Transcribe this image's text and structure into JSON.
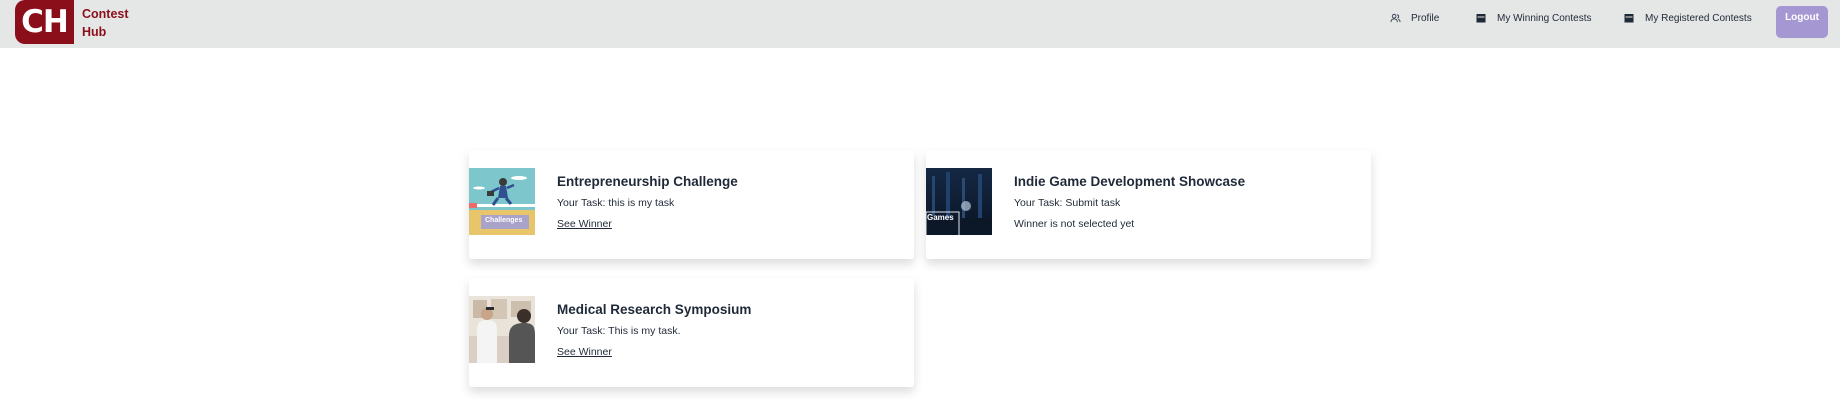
{
  "brand": {
    "badge": "CH",
    "name": "Contest Hub",
    "color": "#8b0f1a"
  },
  "nav": {
    "profile": {
      "label": "Profile",
      "icon": "users-icon"
    },
    "winning": {
      "label": "My Winning Contests",
      "icon": "calendar-icon"
    },
    "registered": {
      "label": "My Registered Contests",
      "icon": "calendar-icon"
    },
    "logout": {
      "label": "Logout",
      "color": "#a497d2"
    }
  },
  "contests": [
    {
      "title": "Entrepreneurship Challenge",
      "task": "Your Task: this is my task",
      "status": "See Winner",
      "status_is_link": true,
      "image": "entrepreneur-challenge-illustration"
    },
    {
      "title": "Indie Game Development Showcase",
      "task": "Your Task: Submit task",
      "status": "Winner is not selected yet",
      "status_is_link": false,
      "image": "indie-game-night-scene",
      "image_text": "Games"
    },
    {
      "title": "Medical Research Symposium",
      "task": "Your Task: This is my task.",
      "status": "See Winner",
      "status_is_link": true,
      "image": "medical-researchers-photo"
    }
  ]
}
